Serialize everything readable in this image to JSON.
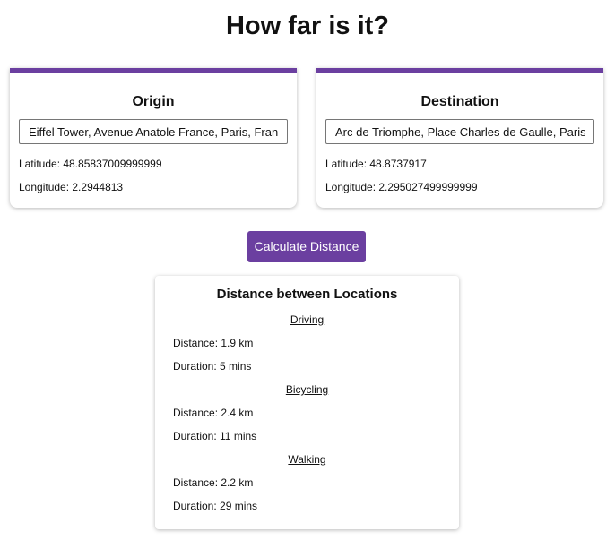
{
  "page": {
    "title": "How far is it?"
  },
  "origin": {
    "heading": "Origin",
    "input_value": "Eiffel Tower, Avenue Anatole France, Paris, France",
    "latitude": "Latitude: 48.85837009999999",
    "longitude": "Longitude: 2.2944813"
  },
  "destination": {
    "heading": "Destination",
    "input_value": "Arc de Triomphe, Place Charles de Gaulle, Paris, France",
    "latitude": "Latitude: 48.8737917",
    "longitude": "Longitude: 2.295027499999999"
  },
  "calculate_button": {
    "label": "Calculate Distance"
  },
  "result": {
    "heading": "Distance between Locations",
    "modes": [
      {
        "name": "Driving",
        "distance": "Distance: 1.9 km",
        "duration": "Duration: 5 mins"
      },
      {
        "name": "Bicycling",
        "distance": "Distance: 2.4 km",
        "duration": "Duration: 11 mins"
      },
      {
        "name": "Walking",
        "distance": "Distance: 2.2 km",
        "duration": "Duration: 29 mins"
      }
    ]
  },
  "colors": {
    "accent": "#6b3fa0",
    "button_text": "#ffffff",
    "text": "#111111",
    "background": "#ffffff"
  }
}
